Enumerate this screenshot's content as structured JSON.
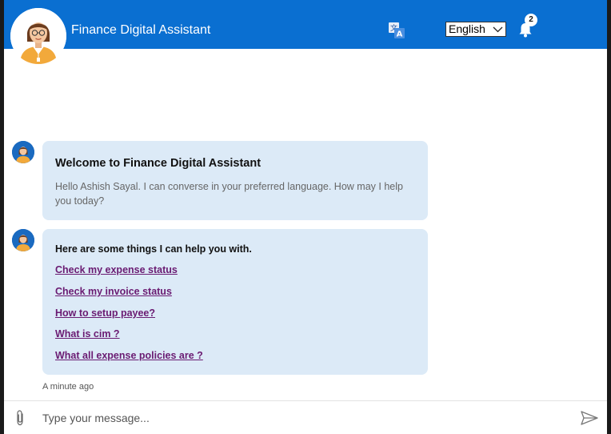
{
  "header": {
    "title": "Finance Digital Assistant",
    "language": "English",
    "notification_count": "2",
    "icons": {
      "translate": "translate-icon",
      "bell": "bell-icon",
      "dropdown": "chevron-down-icon"
    },
    "colors": {
      "header_bg": "#0a6fd1",
      "bubble_bg": "#dceaf7",
      "link": "#6a1b72"
    }
  },
  "messages": [
    {
      "title": "Welcome to Finance Digital Assistant",
      "text": "Hello Ashish Sayal. I can converse in your preferred language. How may I help you today?"
    },
    {
      "intro": "Here are some things I can help you with.",
      "links": [
        "Check my expense status",
        "Check my invoice status",
        "How to setup payee?",
        "What is cim ?",
        "What all expense policies are ?"
      ]
    }
  ],
  "timestamp": "A minute ago",
  "composer": {
    "placeholder": "Type your message...",
    "icons": {
      "attach": "paperclip-icon",
      "send": "send-icon"
    }
  }
}
